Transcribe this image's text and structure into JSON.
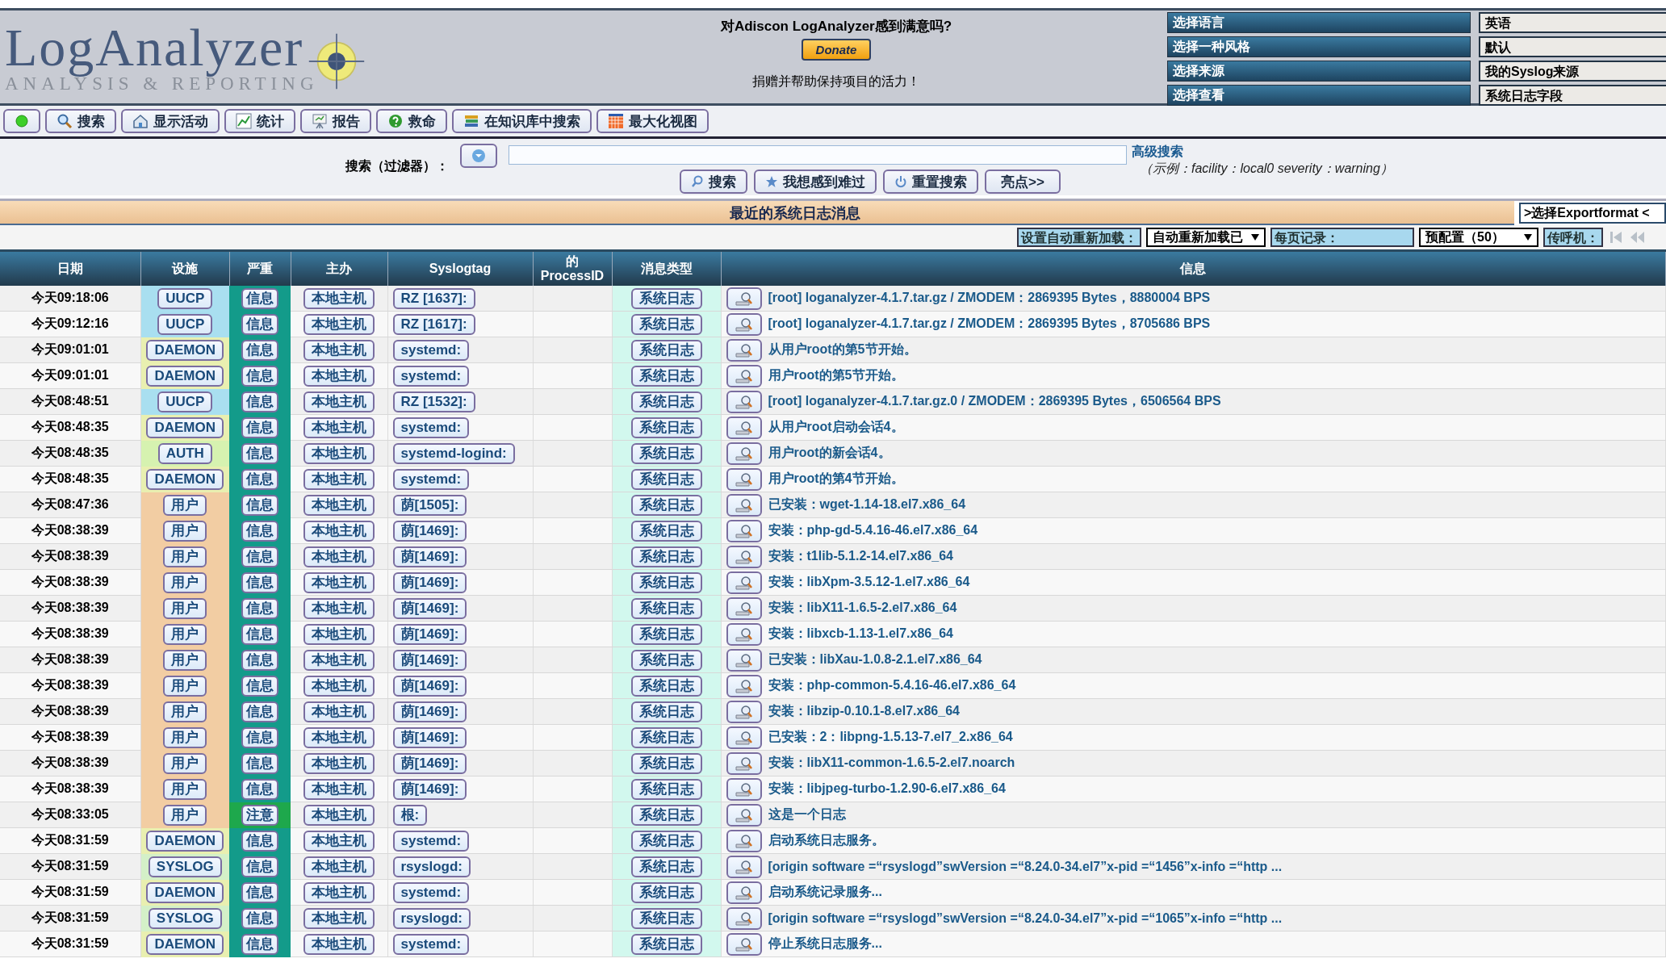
{
  "header": {
    "logo_title": "LogAnalyzer",
    "logo_subtitle": "ANALYSIS & REPORTING",
    "donate_title": "对Adiscon LogAnalyzer感到满意吗?",
    "donate_button": "Donate",
    "donate_note": "捐赠并帮助保持项目的活力！",
    "selectors": [
      {
        "label": "选择语言",
        "value": "英语"
      },
      {
        "label": "选择一种风格",
        "value": "默认"
      },
      {
        "label": "选择来源",
        "value": "我的Syslog来源"
      },
      {
        "label": "选择查看",
        "value": "系统日志字段"
      }
    ]
  },
  "toolbar": [
    {
      "kind": "dot"
    },
    {
      "kind": "search",
      "label": "搜索"
    },
    {
      "kind": "home",
      "label": "显示活动"
    },
    {
      "kind": "chart",
      "label": "统计"
    },
    {
      "kind": "report",
      "label": "报告"
    },
    {
      "kind": "help",
      "label": "救命"
    },
    {
      "kind": "books",
      "label": "在知识库中搜索"
    },
    {
      "kind": "grid",
      "label": "最大化视图"
    }
  ],
  "search": {
    "label": "搜索（过滤器）：",
    "buttons": [
      {
        "kind": "search",
        "label": "搜索"
      },
      {
        "kind": "star",
        "label": "我想感到难过"
      },
      {
        "kind": "reset",
        "label": "重置搜索"
      },
      {
        "kind": "plain",
        "label": "亮点>>"
      }
    ],
    "advanced_link": "高级搜索",
    "example": "（示例：facility：local0 severity：warning）"
  },
  "section_title": "最近的系统日志消息",
  "export_button": ">选择Exportformat <",
  "controls": {
    "reload_label": "设置自动重新加载：",
    "reload_value": "自动重新加载已",
    "per_page_label": "每页记录：",
    "per_page_value": "预配置（50）",
    "pager_label": "传呼机："
  },
  "table": {
    "columns": [
      "日期",
      "设施",
      "严重",
      "主办",
      "Syslogtag",
      "的 ProcessID",
      "消息类型",
      "信息"
    ],
    "rows": [
      {
        "date": "今天09:18:06",
        "facility": {
          "text": "UUCP",
          "color": "#a9dff0"
        },
        "severity": {
          "text": "信息",
          "color": "#139b8a"
        },
        "host": "本地主机",
        "tag": "RZ [1637]:",
        "msgtype": "系统日志",
        "message": "[root] loganalyzer-4.1.7.tar.gz / ZMODEM：2869395 Bytes，8880004 BPS"
      },
      {
        "date": "今天09:12:16",
        "facility": {
          "text": "UUCP",
          "color": "#a9dff0"
        },
        "severity": {
          "text": "信息",
          "color": "#139b8a"
        },
        "host": "本地主机",
        "tag": "RZ [1617]:",
        "msgtype": "系统日志",
        "message": "[root] loganalyzer-4.1.7.tar.gz / ZMODEM：2869395 Bytes，8705686 BPS"
      },
      {
        "date": "今天09:01:01",
        "facility": {
          "text": "DAEMON",
          "color": "#e9efb0"
        },
        "severity": {
          "text": "信息",
          "color": "#139b8a"
        },
        "host": "本地主机",
        "tag": "systemd:",
        "msgtype": "系统日志",
        "message": "从用户root的第5节开始。"
      },
      {
        "date": "今天09:01:01",
        "facility": {
          "text": "DAEMON",
          "color": "#e9efb0"
        },
        "severity": {
          "text": "信息",
          "color": "#139b8a"
        },
        "host": "本地主机",
        "tag": "systemd:",
        "msgtype": "系统日志",
        "message": "用户root的第5节开始。"
      },
      {
        "date": "今天08:48:51",
        "facility": {
          "text": "UUCP",
          "color": "#a9dff0"
        },
        "severity": {
          "text": "信息",
          "color": "#139b8a"
        },
        "host": "本地主机",
        "tag": "RZ [1532]:",
        "msgtype": "系统日志",
        "message": "[root] loganalyzer-4.1.7.tar.gz.0 / ZMODEM：2869395 Bytes，6506564 BPS"
      },
      {
        "date": "今天08:48:35",
        "facility": {
          "text": "DAEMON",
          "color": "#e9efb0"
        },
        "severity": {
          "text": "信息",
          "color": "#139b8a"
        },
        "host": "本地主机",
        "tag": "systemd:",
        "msgtype": "系统日志",
        "message": "从用户root启动会话4。"
      },
      {
        "date": "今天08:48:35",
        "facility": {
          "text": "AUTH",
          "color": "#d6f2b0"
        },
        "severity": {
          "text": "信息",
          "color": "#139b8a"
        },
        "host": "本地主机",
        "tag": "systemd-logind:",
        "msgtype": "系统日志",
        "message": "用户root的新会话4。"
      },
      {
        "date": "今天08:48:35",
        "facility": {
          "text": "DAEMON",
          "color": "#e9efb0"
        },
        "severity": {
          "text": "信息",
          "color": "#139b8a"
        },
        "host": "本地主机",
        "tag": "systemd:",
        "msgtype": "系统日志",
        "message": "用户root的第4节开始。"
      },
      {
        "date": "今天08:47:36",
        "facility": {
          "text": "用户",
          "color": "#f2cda3"
        },
        "severity": {
          "text": "信息",
          "color": "#139b8a"
        },
        "host": "本地主机",
        "tag": "荫[1505]:",
        "msgtype": "系统日志",
        "message": "已安装：wget-1.14-18.el7.x86_64"
      },
      {
        "date": "今天08:38:39",
        "facility": {
          "text": "用户",
          "color": "#f2cda3"
        },
        "severity": {
          "text": "信息",
          "color": "#139b8a"
        },
        "host": "本地主机",
        "tag": "荫[1469]:",
        "msgtype": "系统日志",
        "message": "安装：php-gd-5.4.16-46.el7.x86_64"
      },
      {
        "date": "今天08:38:39",
        "facility": {
          "text": "用户",
          "color": "#f2cda3"
        },
        "severity": {
          "text": "信息",
          "color": "#139b8a"
        },
        "host": "本地主机",
        "tag": "荫[1469]:",
        "msgtype": "系统日志",
        "message": "安装：t1lib-5.1.2-14.el7.x86_64"
      },
      {
        "date": "今天08:38:39",
        "facility": {
          "text": "用户",
          "color": "#f2cda3"
        },
        "severity": {
          "text": "信息",
          "color": "#139b8a"
        },
        "host": "本地主机",
        "tag": "荫[1469]:",
        "msgtype": "系统日志",
        "message": "安装：libXpm-3.5.12-1.el7.x86_64"
      },
      {
        "date": "今天08:38:39",
        "facility": {
          "text": "用户",
          "color": "#f2cda3"
        },
        "severity": {
          "text": "信息",
          "color": "#139b8a"
        },
        "host": "本地主机",
        "tag": "荫[1469]:",
        "msgtype": "系统日志",
        "message": "安装：libX11-1.6.5-2.el7.x86_64"
      },
      {
        "date": "今天08:38:39",
        "facility": {
          "text": "用户",
          "color": "#f2cda3"
        },
        "severity": {
          "text": "信息",
          "color": "#139b8a"
        },
        "host": "本地主机",
        "tag": "荫[1469]:",
        "msgtype": "系统日志",
        "message": "安装：libxcb-1.13-1.el7.x86_64"
      },
      {
        "date": "今天08:38:39",
        "facility": {
          "text": "用户",
          "color": "#f2cda3"
        },
        "severity": {
          "text": "信息",
          "color": "#139b8a"
        },
        "host": "本地主机",
        "tag": "荫[1469]:",
        "msgtype": "系统日志",
        "message": "已安装：libXau-1.0.8-2.1.el7.x86_64"
      },
      {
        "date": "今天08:38:39",
        "facility": {
          "text": "用户",
          "color": "#f2cda3"
        },
        "severity": {
          "text": "信息",
          "color": "#139b8a"
        },
        "host": "本地主机",
        "tag": "荫[1469]:",
        "msgtype": "系统日志",
        "message": "安装：php-common-5.4.16-46.el7.x86_64"
      },
      {
        "date": "今天08:38:39",
        "facility": {
          "text": "用户",
          "color": "#f2cda3"
        },
        "severity": {
          "text": "信息",
          "color": "#139b8a"
        },
        "host": "本地主机",
        "tag": "荫[1469]:",
        "msgtype": "系统日志",
        "message": "安装：libzip-0.10.1-8.el7.x86_64"
      },
      {
        "date": "今天08:38:39",
        "facility": {
          "text": "用户",
          "color": "#f2cda3"
        },
        "severity": {
          "text": "信息",
          "color": "#139b8a"
        },
        "host": "本地主机",
        "tag": "荫[1469]:",
        "msgtype": "系统日志",
        "message": "已安装：2：libpng-1.5.13-7.el7_2.x86_64"
      },
      {
        "date": "今天08:38:39",
        "facility": {
          "text": "用户",
          "color": "#f2cda3"
        },
        "severity": {
          "text": "信息",
          "color": "#139b8a"
        },
        "host": "本地主机",
        "tag": "荫[1469]:",
        "msgtype": "系统日志",
        "message": "安装：libX11-common-1.6.5-2.el7.noarch"
      },
      {
        "date": "今天08:38:39",
        "facility": {
          "text": "用户",
          "color": "#f2cda3"
        },
        "severity": {
          "text": "信息",
          "color": "#139b8a"
        },
        "host": "本地主机",
        "tag": "荫[1469]:",
        "msgtype": "系统日志",
        "message": "安装：libjpeg-turbo-1.2.90-6.el7.x86_64"
      },
      {
        "date": "今天08:33:05",
        "facility": {
          "text": "用户",
          "color": "#f2cda3"
        },
        "severity": {
          "text": "注意",
          "color": "#1ea84c"
        },
        "host": "本地主机",
        "tag": "根:",
        "msgtype": "系统日志",
        "message": "这是一个日志"
      },
      {
        "date": "今天08:31:59",
        "facility": {
          "text": "DAEMON",
          "color": "#e9efb0"
        },
        "severity": {
          "text": "信息",
          "color": "#139b8a"
        },
        "host": "本地主机",
        "tag": "systemd:",
        "msgtype": "系统日志",
        "message": "启动系统日志服务。"
      },
      {
        "date": "今天08:31:59",
        "facility": {
          "text": "SYSLOG",
          "color": "#d4f0c8"
        },
        "severity": {
          "text": "信息",
          "color": "#139b8a"
        },
        "host": "本地主机",
        "tag": "rsyslogd:",
        "msgtype": "系统日志",
        "message": "[origin software =“rsyslogd”swVersion =“8.24.0-34.el7”x-pid =“1456”x-info =“http ..."
      },
      {
        "date": "今天08:31:59",
        "facility": {
          "text": "DAEMON",
          "color": "#e9efb0"
        },
        "severity": {
          "text": "信息",
          "color": "#139b8a"
        },
        "host": "本地主机",
        "tag": "systemd:",
        "msgtype": "系统日志",
        "message": "启动系统记录服务..."
      },
      {
        "date": "今天08:31:59",
        "facility": {
          "text": "SYSLOG",
          "color": "#d4f0c8"
        },
        "severity": {
          "text": "信息",
          "color": "#139b8a"
        },
        "host": "本地主机",
        "tag": "rsyslogd:",
        "msgtype": "系统日志",
        "message": "[origin software =“rsyslogd”swVersion =“8.24.0-34.el7”x-pid =“1065”x-info =“http ..."
      },
      {
        "date": "今天08:31:59",
        "facility": {
          "text": "DAEMON",
          "color": "#e9efb0"
        },
        "severity": {
          "text": "信息",
          "color": "#139b8a"
        },
        "host": "本地主机",
        "tag": "systemd:",
        "msgtype": "系统日志",
        "message": "停止系统日志服务..."
      }
    ]
  }
}
